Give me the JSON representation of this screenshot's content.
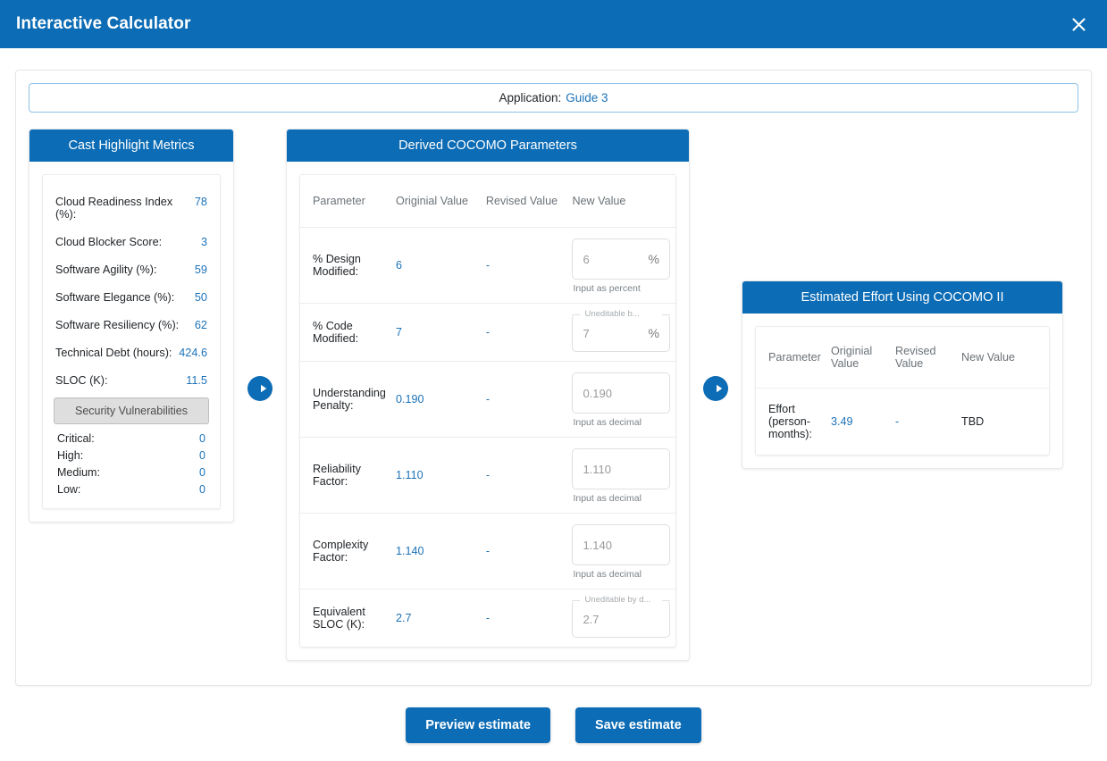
{
  "window": {
    "title": "Interactive Calculator",
    "close_icon": "close-icon"
  },
  "application_bar": {
    "label": "Application:",
    "name": "Guide 3"
  },
  "left_panel": {
    "title": "Cast Highlight Metrics",
    "metrics": [
      {
        "label": "Cloud Readiness Index (%):",
        "value": "78"
      },
      {
        "label": "Cloud Blocker Score:",
        "value": "3"
      },
      {
        "label": "Software Agility (%):",
        "value": "59"
      },
      {
        "label": "Software Elegance (%):",
        "value": "50"
      },
      {
        "label": "Software Resiliency (%):",
        "value": "62"
      },
      {
        "label": "Technical Debt (hours):",
        "value": "424.6"
      },
      {
        "label": "SLOC (K):",
        "value": "11.5"
      }
    ],
    "security_button": "Security Vulnerabilities",
    "severities": [
      {
        "label": "Critical:",
        "value": "0"
      },
      {
        "label": "High:",
        "value": "0"
      },
      {
        "label": "Medium:",
        "value": "0"
      },
      {
        "label": "Low:",
        "value": "0"
      }
    ]
  },
  "arrows": {
    "first": "arrow-right-circle-icon",
    "second": "arrow-right-circle-icon"
  },
  "mid_panel": {
    "title": "Derived COCOMO Parameters",
    "columns": [
      "Parameter",
      "Originial Value",
      "Revised Value",
      "New Value"
    ],
    "rows": [
      {
        "parameter": "% Design Modified:",
        "original": "6",
        "revised": "-",
        "input_value": "6",
        "suffix": "%",
        "hint": "Input as percent",
        "float_label": "",
        "editable": true
      },
      {
        "parameter": "% Code Modified:",
        "original": "7",
        "revised": "-",
        "input_value": "7",
        "suffix": "%",
        "hint": "",
        "float_label": "Uneditable b...",
        "editable": false
      },
      {
        "parameter": "Understanding Penalty:",
        "original": "0.190",
        "revised": "-",
        "input_value": "0.190",
        "suffix": "",
        "hint": "Input as decimal",
        "float_label": "",
        "editable": true
      },
      {
        "parameter": "Reliability Factor:",
        "original": "1.110",
        "revised": "-",
        "input_value": "1.110",
        "suffix": "",
        "hint": "Input as decimal",
        "float_label": "",
        "editable": true
      },
      {
        "parameter": "Complexity Factor:",
        "original": "1.140",
        "revised": "-",
        "input_value": "1.140",
        "suffix": "",
        "hint": "Input as decimal",
        "float_label": "",
        "editable": true
      },
      {
        "parameter": "Equivalent SLOC (K):",
        "original": "2.7",
        "revised": "-",
        "input_value": "2.7",
        "suffix": "",
        "hint": "",
        "float_label": "Uneditable by d...",
        "editable": false
      }
    ]
  },
  "right_panel": {
    "title": "Estimated Effort Using COCOMO II",
    "columns": [
      "Parameter",
      "Originial Value",
      "Revised Value",
      "New Value"
    ],
    "rows": [
      {
        "parameter": "Effort (person-months):",
        "original": "3.49",
        "revised": "-",
        "new_value": "TBD"
      }
    ]
  },
  "footer": {
    "preview_label": "Preview estimate",
    "save_label": "Save estimate"
  },
  "colors": {
    "brand_blue": "#0c6cb5",
    "link_blue": "#1b72b8",
    "app_bar_border": "#8cc2e8",
    "muted_text": "#6b7278"
  }
}
